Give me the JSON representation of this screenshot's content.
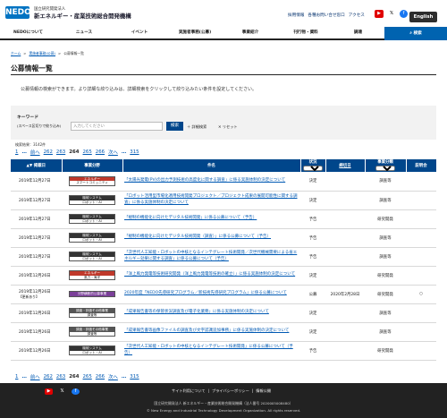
{
  "header": {
    "logo_text": "NEDO",
    "org_line1": "国立研究開発法人",
    "org_line2": "新エネルギー・産業技術総合開発機構",
    "links": [
      "採用情報",
      "各種お問い合せ窓口",
      "アクセス"
    ],
    "sns": [
      "youtube-icon",
      "x-icon",
      "facebook-icon"
    ],
    "english_label": "English"
  },
  "nav": {
    "items": [
      "NEDOについて",
      "ニュース",
      "イベント",
      "実施者事務(公募)",
      "事業紹介",
      "刊行物・資料",
      "調達"
    ],
    "search_label": "検索"
  },
  "breadcrumb": [
    "ホーム",
    "実施者事務(公募)",
    "公募情報一覧"
  ],
  "page": {
    "title": "公募情報一覧",
    "intro": "公募情報の検索ができます。より詳細な絞り込みは、詳細検索をクリックして絞り込みたい条件を設定してください。"
  },
  "search": {
    "keyword_label": "キーワード",
    "keyword_hint": "(スペース区切りで絞り込み)",
    "placeholder": "入力してください",
    "button": "検索",
    "advanced": "詳細検索",
    "reset": "リセット"
  },
  "results": {
    "count_text": "検索結果：3142件",
    "pager": {
      "first": "1",
      "prev": "前へ",
      "pages": [
        "262",
        "263",
        "264",
        "265",
        "266"
      ],
      "current": "264",
      "next": "次へ",
      "last": "315",
      "ellipsis": "…"
    }
  },
  "table": {
    "headers": {
      "date": "掲載日",
      "category": "事業分野",
      "title": "件名",
      "status": "状況",
      "deadline": "締切日",
      "kind": "事業分類",
      "note": "説明会"
    },
    "filter_all": "すべて",
    "rows": [
      {
        "date": "2019年12月27日",
        "cat1": "エネルギー",
        "cat2": "スマートコミュニティ",
        "cat_color": "#c0392b",
        "title": "「太陽光発電(PV)の出力予測技術の高度化に関する調査」に係る実施体制の決定について",
        "status": "決定",
        "deadline": "",
        "kind": "調査等",
        "note": ""
      },
      {
        "date": "2019年12月27日",
        "cat1": "機械システム",
        "cat2": "ロボット・AI",
        "cat_color": "#333333",
        "title": "「ロボット活用型市場化適用技術開発プロジェクト／プロジェクト成果の展開可能性に関する調査」に係る実施体制の決定について",
        "status": "決定",
        "deadline": "",
        "kind": "調査等",
        "note": ""
      },
      {
        "date": "2019年12月27日",
        "cat1": "機械システム",
        "cat2": "ロボット・AI",
        "cat_color": "#333333",
        "title": "「規制の機能化に向けたデジタル技術開発」に係る公募について（予告）",
        "status": "予告",
        "deadline": "",
        "kind": "研究開発",
        "note": ""
      },
      {
        "date": "2019年12月27日",
        "cat1": "機械システム",
        "cat2": "ロボット・AI",
        "cat_color": "#333333",
        "title": "「規制の機能化に向けたデジタル技術開発（調査）」に係る公募について（予告）",
        "status": "予告",
        "deadline": "",
        "kind": "調査等",
        "note": ""
      },
      {
        "date": "2019年12月27日",
        "cat1": "機械システム",
        "cat2": "ロボット・AI",
        "cat_color": "#333333",
        "title": "「次世代人工知能・ロボットの中核となるインテグレート技術開発／次世代機械需要による省エネルギー効果に関する調査」に係る公募について（予告）",
        "status": "予告",
        "deadline": "",
        "kind": "調査等",
        "note": ""
      },
      {
        "date": "2019年12月26日",
        "cat1": "エネルギー",
        "cat2": "風力・海洋",
        "cat_color": "#c0392b",
        "title": "「洋上風力発電等技術研究開発（洋上風力発電等技術の確立）」に係る実施体制の決定について",
        "status": "決定",
        "deadline": "",
        "kind": "研究開発",
        "note": ""
      },
      {
        "date": "2019年12月26日",
        "new": "【更新あり】",
        "cat1": "分野横断的公募事業",
        "cat2": "",
        "cat_color": "#7b3f99",
        "title": "2020年度「NEDO先導研究プログラム／新技術先導研究プログラム」に係る公募について",
        "status": "公募",
        "deadline": "2020年2月28日",
        "kind": "研究開発",
        "note": "○"
      },
      {
        "date": "2019年12月26日",
        "cat1": "調査・評価その他事業",
        "cat2": "調査等",
        "cat_color": "#555555",
        "title": "「成果報告書等の保管状況調査及び電子化業務」に係る実施体制の決定について",
        "status": "決定",
        "deadline": "",
        "kind": "調査等",
        "note": ""
      },
      {
        "date": "2019年12月26日",
        "cat1": "調査・評価その他事業",
        "cat2": "調査等",
        "cat_color": "#555555",
        "title": "「成果報告書等画像ファイルの調査及び文字認識追加事務」に係る実施体制の決定について",
        "status": "決定",
        "deadline": "",
        "kind": "調査等",
        "note": ""
      },
      {
        "date": "2019年12月26日",
        "cat1": "機械システム",
        "cat2": "ロボット・AI",
        "cat_color": "#333333",
        "title": "「次世代人工知能・ロボットの中核となるインテグレート技術開発」に係る公募について（予告）",
        "status": "予告",
        "deadline": "",
        "kind": "研究開発",
        "note": ""
      }
    ]
  },
  "footer": {
    "links": [
      "サイト利用について",
      "プライバシーポリシー",
      "情報公開"
    ],
    "address": "国立研究開発法人 新エネルギー・産業技術総合開発機構（法人番号 2020005008480）",
    "copyright": "© New Energy and Industrial Technology Development Organization. All rights reserved."
  }
}
